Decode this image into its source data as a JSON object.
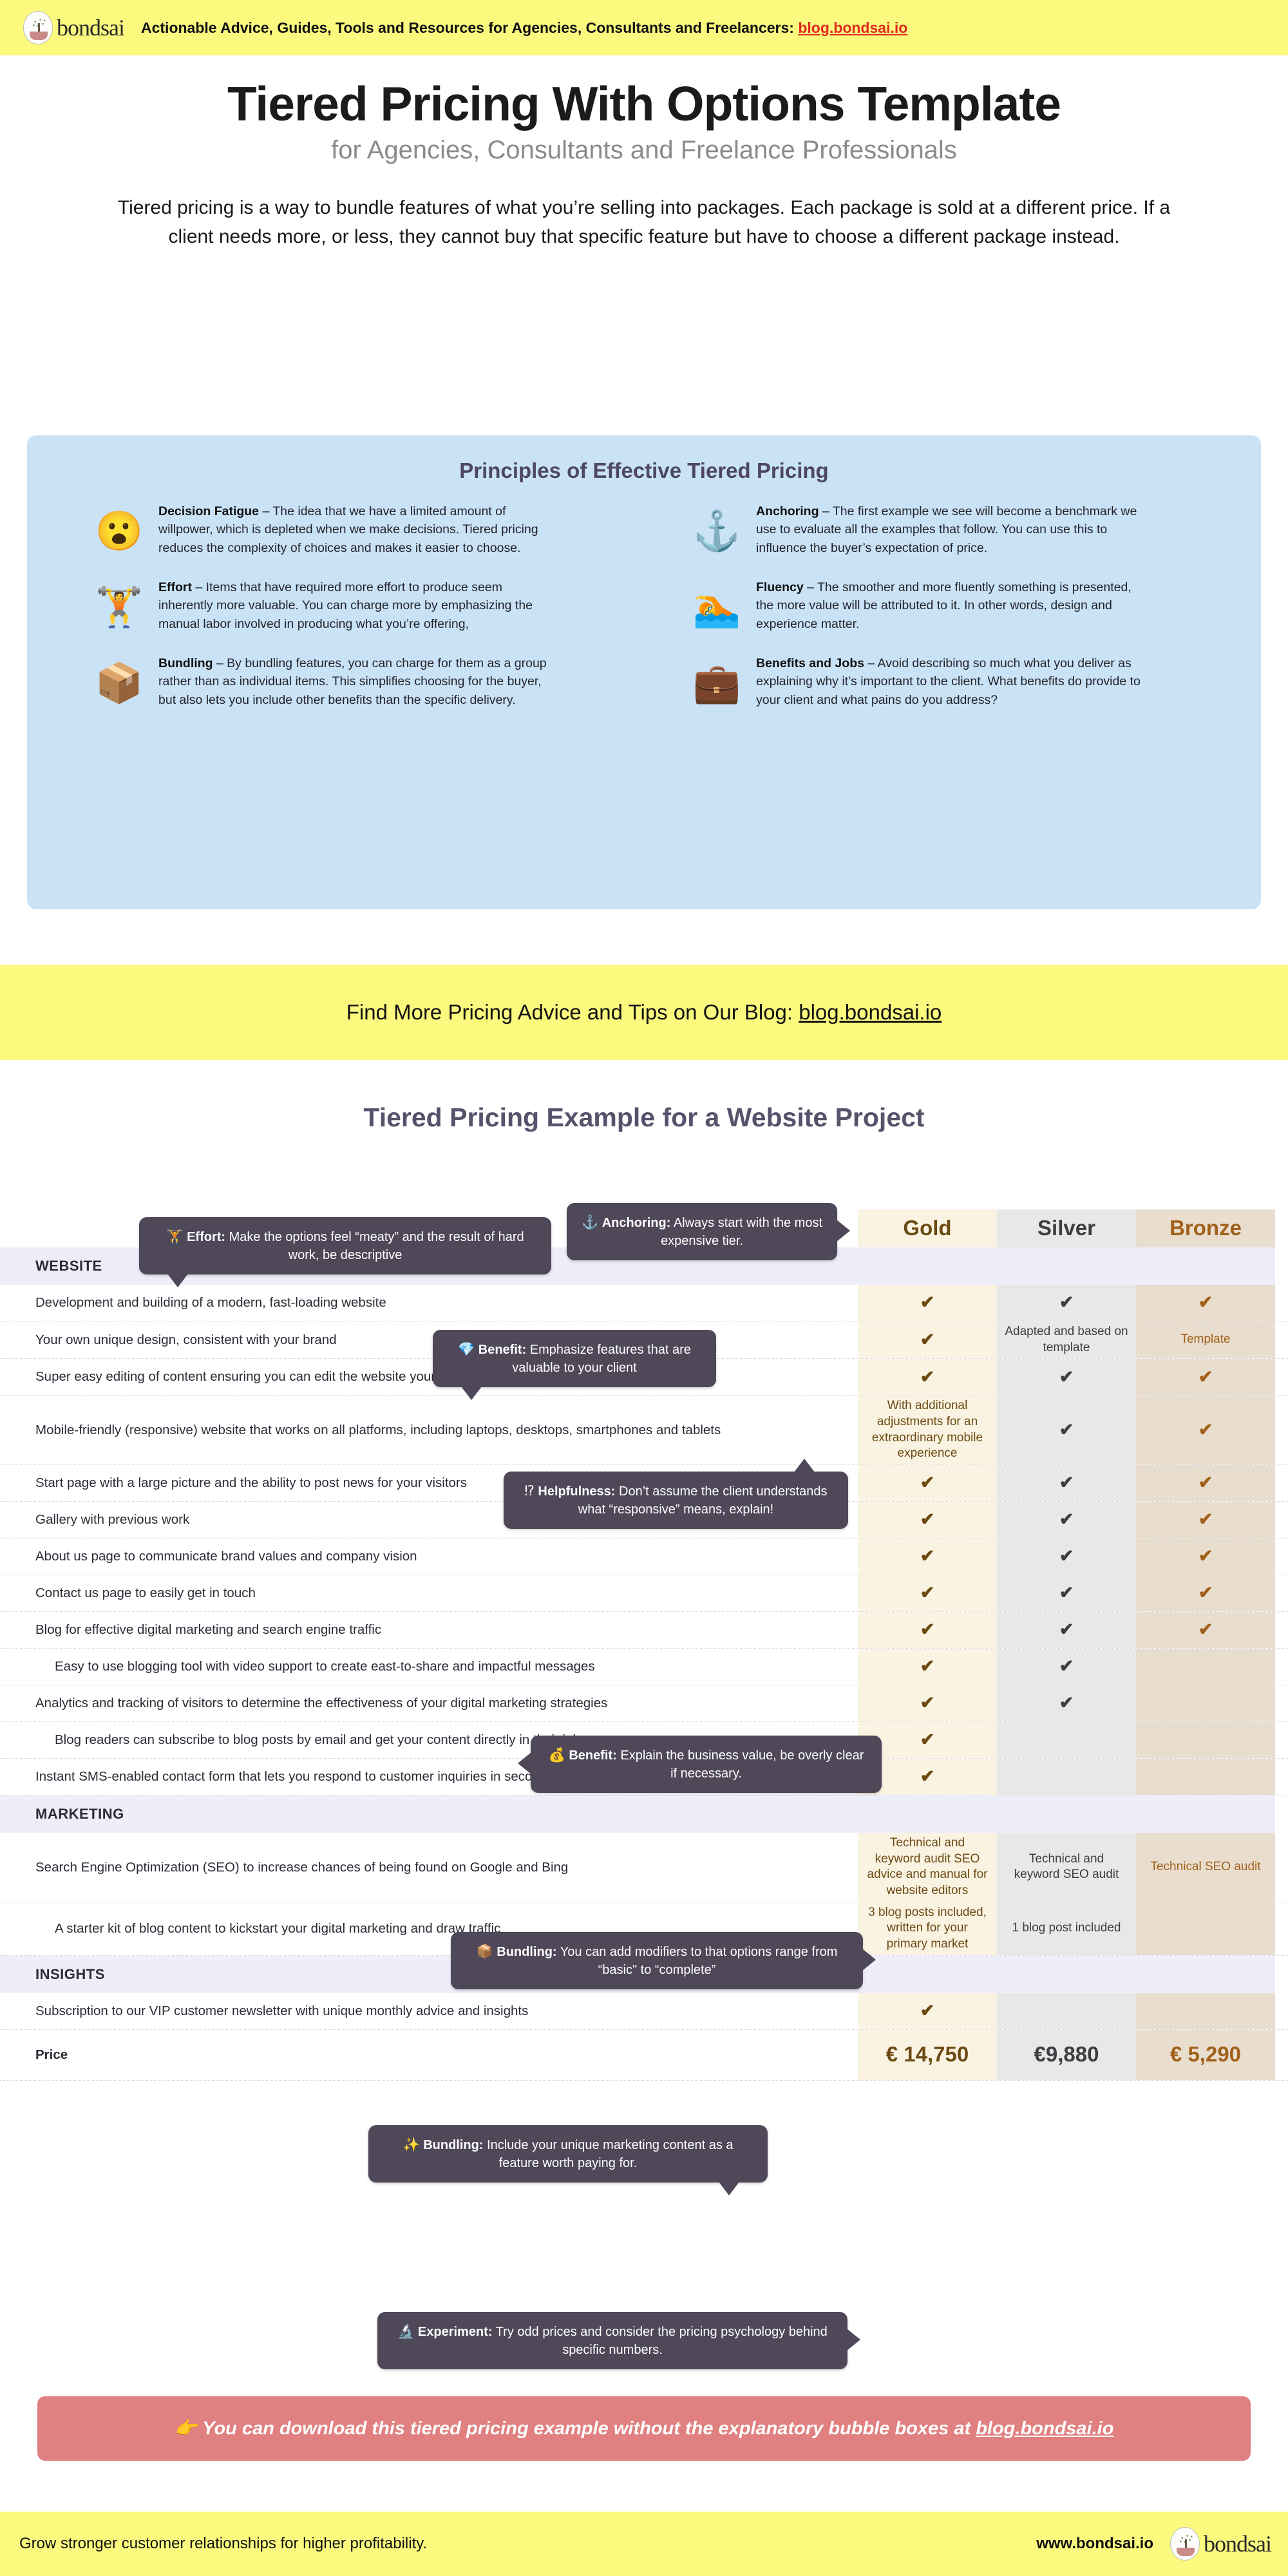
{
  "topbar": {
    "logo_text": "bondsai",
    "tagline": "Actionable Advice, Guides, Tools and Resources for Agencies, Consultants and Freelancers:",
    "link": "blog.bondsai.io"
  },
  "hero": {
    "title": "Tiered Pricing With Options Template",
    "subtitle": "for Agencies, Consultants and Freelance Professionals",
    "intro": "Tiered pricing is a way to bundle features of what you’re selling into packages. Each package is sold at a different price. If a client needs more, or less, they cannot buy that specific feature but have to choose a different package instead."
  },
  "principles": {
    "heading": "Principles of Effective Tiered Pricing",
    "left": [
      {
        "icon": "face-blowing-emoji",
        "glyph": "😮",
        "term": "Decision Fatigue",
        "body": " – The idea that we have a limited amount of willpower, which is depleted when we make decisions. Tiered pricing reduces the complexity of choices and makes it easier to choose."
      },
      {
        "icon": "dumbbell-icon",
        "glyph": "🏋",
        "term": "Effort",
        "body": " – Items that have required more effort to produce seem inherently more valuable. You can charge more by emphasizing the manual labor involved in producing what you’re offering,"
      },
      {
        "icon": "package-box-icon",
        "glyph": "📦",
        "term": "Bundling",
        "body": " – By bundling features, you can charge for them as a group rather than as individual items. This simplifies choosing for the buyer, but also lets you include other benefits than the specific delivery."
      }
    ],
    "right": [
      {
        "icon": "anchor-icon",
        "glyph": "⚓",
        "term": "Anchoring",
        "body": " – The first example we see will become a benchmark we use to evaluate all the examples that follow. You can use this to influence the buyer’s expectation of price."
      },
      {
        "icon": "swimmer-icon",
        "glyph": "🏊",
        "term": "Fluency",
        "body": " – The smoother and more fluently something is presented, the more value will be attributed to it. In other words, design and experience matter."
      },
      {
        "icon": "briefcase-icon",
        "glyph": "💼",
        "term": "Benefits and Jobs",
        "body": " – Avoid describing so much what you deliver as explaining why it’s important to the client. What benefits do provide to your client and what pains do you address?"
      }
    ]
  },
  "midbar": {
    "text": "Find More Pricing Advice and Tips on Our Blog: ",
    "link": "blog.bondsai.io"
  },
  "section_title": "Tiered Pricing Example for a Website Project",
  "table": {
    "columns": [
      "Gold",
      "Silver",
      "Bronze"
    ],
    "groups": [
      {
        "name": "WEBSITE"
      },
      {
        "name": "MARKETING"
      },
      {
        "name": "INSIGHTS"
      }
    ],
    "rows": [
      {
        "group": "WEBSITE",
        "type": "group"
      },
      {
        "label": "Development and building of a modern, fast-loading website",
        "gold": "✔",
        "silver": "✔",
        "bronze": "✔"
      },
      {
        "label": "Your own unique design, consistent with your brand",
        "gold": "✔",
        "silver": "Adapted and based on template",
        "bronze": "Template"
      },
      {
        "label": "Super easy editing of content ensuring you can edit the website yourselves",
        "gold": "✔",
        "silver": "✔",
        "bronze": "✔"
      },
      {
        "label": "Mobile-friendly (responsive) website that works on all platforms, including laptops, desktops, smartphones and tablets",
        "gold": "With additional adjustments for an extraordinary mobile experience",
        "silver": "✔",
        "bronze": "✔"
      },
      {
        "label": "Start page with a large picture and the ability to post news for your visitors",
        "gold": "✔",
        "silver": "✔",
        "bronze": "✔"
      },
      {
        "label": "Gallery with previous work",
        "gold": "✔",
        "silver": "✔",
        "bronze": "✔"
      },
      {
        "label": "About us page to communicate brand values and company vision",
        "gold": "✔",
        "silver": "✔",
        "bronze": "✔"
      },
      {
        "label": "Contact us page to easily get in touch",
        "gold": "✔",
        "silver": "✔",
        "bronze": "✔"
      },
      {
        "label": "Blog for effective digital marketing and search engine traffic",
        "gold": "✔",
        "silver": "✔",
        "bronze": "✔"
      },
      {
        "label": "Easy to use blogging tool with video support to create east-to-share and impactful messages",
        "indent": true,
        "gold": "✔",
        "silver": "✔",
        "bronze": ""
      },
      {
        "label": "Analytics and tracking of visitors to determine the effectiveness of your digital marketing strategies",
        "gold": "✔",
        "silver": "✔",
        "bronze": ""
      },
      {
        "label": "Blog readers can subscribe to blog posts by email and get your content directly in their inbox",
        "indent": true,
        "gold": "✔",
        "silver": "",
        "bronze": ""
      },
      {
        "label": "Instant SMS-enabled contact form that lets you respond to customer inquiries in seconds",
        "gold": "✔",
        "silver": "",
        "bronze": ""
      },
      {
        "group": "MARKETING",
        "type": "group"
      },
      {
        "label": "Search Engine Optimization (SEO) to increase chances of being found on Google and Bing",
        "gold": "Technical and keyword audit SEO advice and manual for website editors",
        "silver": "Technical and keyword SEO audit",
        "bronze": "Technical SEO audit"
      },
      {
        "label": "A starter kit of blog content to kickstart your digital marketing and draw traffic",
        "indent": true,
        "gold": "3 blog posts included, written for your primary market",
        "silver": "1 blog post included",
        "bronze": ""
      },
      {
        "group": "INSIGHTS",
        "type": "group"
      },
      {
        "label": "Subscription to our VIP customer newsletter with unique monthly advice and insights",
        "gold": "✔",
        "silver": "",
        "bronze": ""
      },
      {
        "label": "Price",
        "is_price": true,
        "gold": "€ 14,750",
        "silver": "€9,880",
        "bronze": "€ 5,290"
      }
    ]
  },
  "bubbles": [
    {
      "id": "effort",
      "glyph": "🏋",
      "icon": "weightlifter-icon",
      "term": "Effort:",
      "text": " Make the options feel “meaty” and the result of hard work, be descriptive"
    },
    {
      "id": "anchoring",
      "glyph": "⚓",
      "icon": "anchor-icon",
      "term": "Anchoring:",
      "text": " Always start with the most expensive tier."
    },
    {
      "id": "benefit1",
      "glyph": "💎",
      "icon": "gem-icon",
      "term": "Benefit:",
      "text": " Emphasize features that are valuable to your client"
    },
    {
      "id": "helpfulness",
      "glyph": "⁉",
      "icon": "interrobang-icon",
      "term": "Helpfulness:",
      "text": " Don’t assume the client understands what “responsive” means, explain!"
    },
    {
      "id": "benefit2",
      "glyph": "💰",
      "icon": "money-bag-icon",
      "term": "Benefit:",
      "text": " Explain the business value, be overly clear if necessary."
    },
    {
      "id": "bundling1",
      "glyph": "📦",
      "icon": "package-box-icon",
      "term": "Bundling:",
      "text": " You can add modifiers to that options range from “basic\" to “complete”"
    },
    {
      "id": "bundling2",
      "glyph": "✨",
      "icon": "sparkles-icon",
      "term": "Bundling:",
      "text": " Include your unique marketing content as a feature worth paying for."
    },
    {
      "id": "experiment",
      "glyph": "🔬",
      "icon": "microscope-icon",
      "term": "Experiment:",
      "text": " Try odd prices and consider the pricing psychology behind specific numbers."
    }
  ],
  "cta": {
    "glyph": "👉",
    "text": "You can download this tiered pricing example without the explanatory bubble boxes at ",
    "link": "blog.bondsai.io"
  },
  "footer": {
    "tagline": "Grow stronger customer relationships for higher profitability.",
    "url": "www.bondsai.io",
    "logo_text": "bondsai"
  },
  "colors": {
    "yellow": "#fbfa7f",
    "panel_blue": "#c9e2f5",
    "bubble": "#4e4859",
    "gold": "#fbf3e2",
    "silver": "#e8e8e8",
    "bronze": "#e9ddcd",
    "cta_red": "#e08080",
    "link_red": "#e02b20"
  }
}
